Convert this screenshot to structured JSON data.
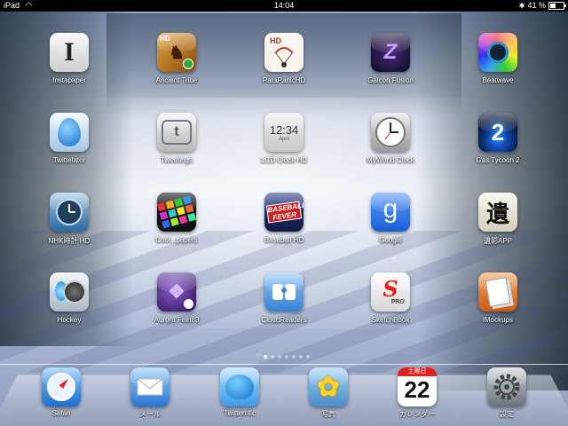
{
  "status_bar": {
    "carrier": "iPad",
    "time": "14:04",
    "battery_percent_text": "41 %",
    "battery_level": 0.41
  },
  "apps": [
    {
      "label": "Instapaper",
      "icon": "instapaper-icon",
      "glyph": "I"
    },
    {
      "label": "Ancient Tribe",
      "icon": "ancient-tribe-icon",
      "glyph": "HD"
    },
    {
      "label": "ParaPanicHD",
      "icon": "parapanic-icon",
      "glyph": "HD"
    },
    {
      "label": "Galcon Fusion",
      "icon": "galcon-fusion-icon",
      "glyph": ""
    },
    {
      "label": "Beatwave",
      "icon": "beatwave-icon",
      "glyph": ""
    },
    {
      "label": "Twittelator",
      "icon": "twittelator-icon",
      "glyph": ""
    },
    {
      "label": "Tweetings",
      "icon": "tweetings-icon",
      "glyph": "t"
    },
    {
      "label": "LCD Clock HD",
      "icon": "lcd-clock-icon",
      "glyph": "12:34",
      "sub": "April"
    },
    {
      "label": "MyWorld Clock",
      "icon": "clock-icon",
      "glyph": ""
    },
    {
      "label": "Gas Tycoon 2",
      "icon": "gas-tycoon-icon",
      "glyph": "2"
    },
    {
      "label": "NHK時計 HD",
      "icon": "nhk-clock-icon",
      "glyph": ""
    },
    {
      "label": "Cool...papers",
      "icon": "coolpapers-icon",
      "glyph": ""
    },
    {
      "label": "Baseball HD",
      "icon": "baseball-icon",
      "glyph": "BASEBALL FEVER"
    },
    {
      "label": "Google",
      "icon": "google-icon",
      "glyph": "g"
    },
    {
      "label": "遺影APP",
      "icon": "iei-app-icon",
      "glyph": "遺"
    },
    {
      "label": "Hockey",
      "icon": "hockey-icon",
      "glyph": ""
    },
    {
      "label": "Aurora Feint 3",
      "icon": "aurora-feint-icon",
      "glyph": ""
    },
    {
      "label": "CloudReaders",
      "icon": "cloudreaders-icon",
      "glyph": ""
    },
    {
      "label": "SketchBook",
      "icon": "sketchbook-icon",
      "glyph": "S",
      "sub": "PRO"
    },
    {
      "label": "iMockups",
      "icon": "imockups-icon",
      "glyph": ""
    }
  ],
  "dock": [
    {
      "label": "Safari",
      "icon": "safari-icon"
    },
    {
      "label": "メール",
      "icon": "mail-icon"
    },
    {
      "label": "Twitterrific",
      "icon": "twitterrific-icon"
    },
    {
      "label": "写真",
      "icon": "photos-icon"
    },
    {
      "label": "カレンダー",
      "icon": "calendar-icon",
      "day_name": "土曜日",
      "day": "22"
    },
    {
      "label": "設定",
      "icon": "settings-icon"
    }
  ],
  "page_indicator": {
    "pages": 7,
    "active": 0
  }
}
